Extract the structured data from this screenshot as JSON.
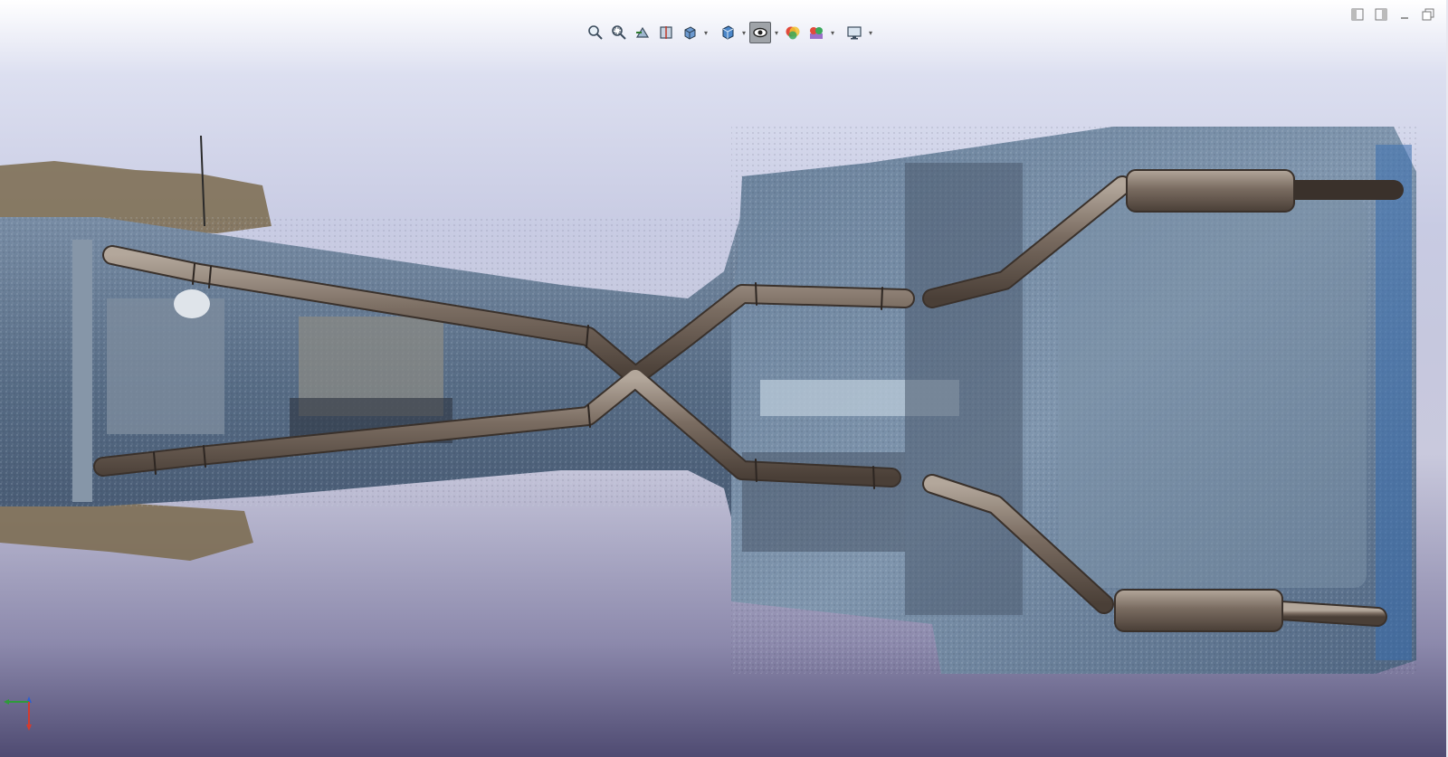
{
  "app": {
    "view_type": "3D model viewport — point cloud of car underbody with exhaust system"
  },
  "heads_up_toolbar": {
    "items": [
      {
        "name": "zoom-to-fit-icon",
        "active": false
      },
      {
        "name": "zoom-to-area-icon",
        "active": false
      },
      {
        "name": "previous-view-icon",
        "active": false
      },
      {
        "name": "section-view-icon",
        "active": false
      },
      {
        "name": "view-orientation-icon",
        "active": false,
        "dropdown": true
      },
      {
        "name": "display-style-icon",
        "active": false,
        "dropdown": true
      },
      {
        "name": "hide-show-items-icon",
        "active": true,
        "dropdown": true
      },
      {
        "name": "edit-appearance-icon",
        "active": false
      },
      {
        "name": "apply-scene-icon",
        "active": false,
        "dropdown": true
      },
      {
        "name": "view-settings-icon",
        "active": false,
        "dropdown": true
      }
    ]
  },
  "window_controls": [
    "tile-left-icon",
    "tile-right-icon",
    "minimize-icon",
    "restore-icon"
  ],
  "colors": {
    "pipe": "#6b5e54",
    "pipe_highlight": "#a99d92",
    "underbody": "#58708c",
    "triad_x": "#d43b2e",
    "triad_y": "#2e9b3a",
    "triad_z": "#2d5fd1"
  }
}
